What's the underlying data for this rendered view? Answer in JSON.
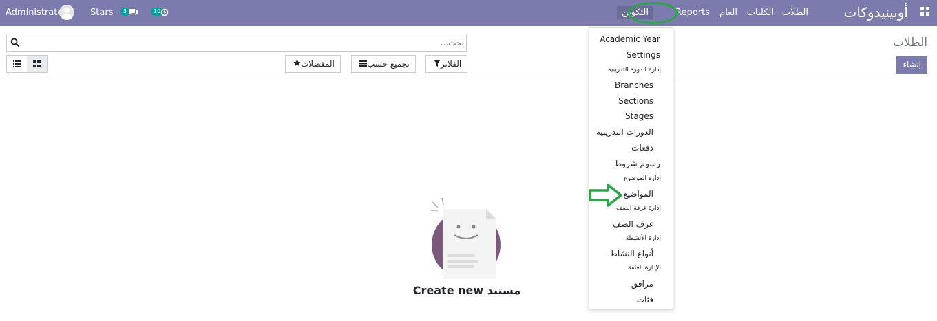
{
  "navbar": {
    "brand": "أوبينيدوكات",
    "menu": [
      "الطلاب",
      "الكليات",
      "العام",
      "Reports",
      "التكوين"
    ],
    "active_menu": "التكوين",
    "stars_label": "Stars",
    "messages_count": "3",
    "activities_count": "10",
    "user_name": "Administrator"
  },
  "control_panel": {
    "title": "الطلاب",
    "create_label": "إنشاء",
    "search_placeholder": "بحث...",
    "filters_label": "الفلاتر",
    "group_by_label": "تجميع حسب",
    "favorites_label": "المفضلات"
  },
  "dropdown": {
    "items": [
      {
        "type": "item",
        "label": "Academic Year"
      },
      {
        "type": "item",
        "label": "Settings"
      },
      {
        "type": "header",
        "label": "إدارة الدورة التدريبية"
      },
      {
        "type": "item",
        "label": "Branches"
      },
      {
        "type": "item",
        "label": "Sections"
      },
      {
        "type": "item",
        "label": "Stages"
      },
      {
        "type": "item",
        "label": "الدورات التدريبية"
      },
      {
        "type": "item",
        "label": "دفعات"
      },
      {
        "type": "item",
        "label": "رسوم شروط"
      },
      {
        "type": "header",
        "label": "إدارة الموضوع"
      },
      {
        "type": "item",
        "label": "المواضيع"
      },
      {
        "type": "header",
        "label": "إدارة غرفة الصف"
      },
      {
        "type": "item",
        "label": "غرف الصف"
      },
      {
        "type": "header",
        "label": "إدارة الأنشطة"
      },
      {
        "type": "item",
        "label": "أنواع النشاط"
      },
      {
        "type": "header",
        "label": "الإدارة العامة"
      },
      {
        "type": "item",
        "label": "مرافق"
      },
      {
        "type": "item",
        "label": "فئات"
      }
    ]
  },
  "empty_state": {
    "text": "Create new مستند"
  },
  "colors": {
    "navbar": "#7c7bad",
    "badge": "#00a09d",
    "annotation_green": "#28a745"
  }
}
